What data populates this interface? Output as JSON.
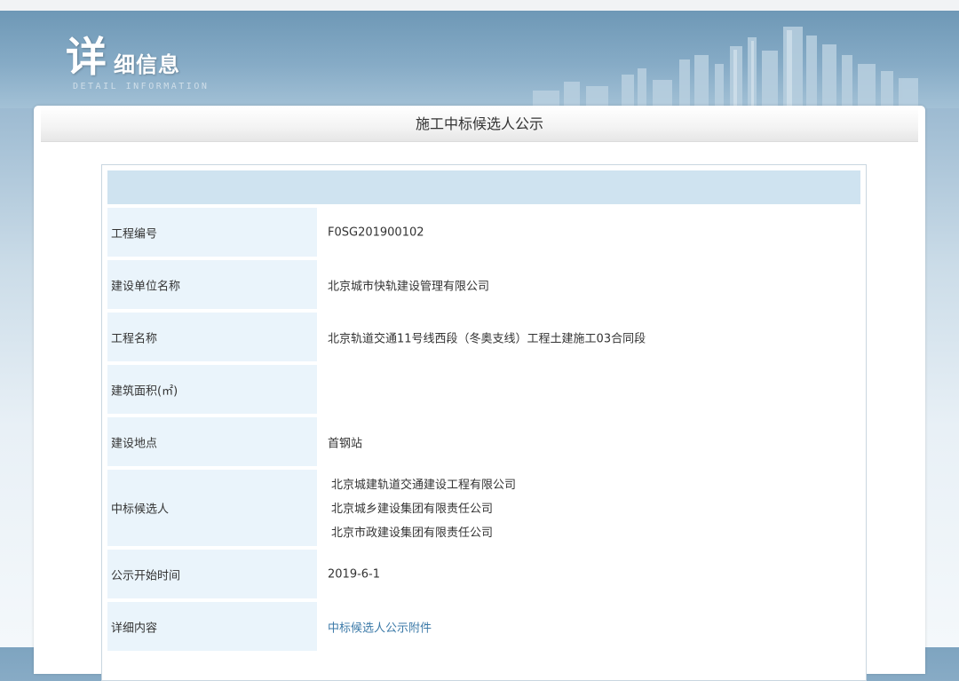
{
  "banner": {
    "logo_big": "详",
    "logo_rest": "细信息",
    "logo_en": "DETAIL INFORMATION"
  },
  "panel": {
    "title": "施工中标候选人公示"
  },
  "rows": [
    {
      "label": "工程编号",
      "value": "F0SG201900102"
    },
    {
      "label": "建设单位名称",
      "value": "北京城市快轨建设管理有限公司"
    },
    {
      "label": "工程名称",
      "value": "北京轨道交通11号线西段（冬奥支线）工程土建施工03合同段"
    },
    {
      "label": "建筑面积(㎡)",
      "value": ""
    },
    {
      "label": "建设地点",
      "value": "首钢站"
    },
    {
      "label": "中标候选人",
      "values": [
        "北京城建轨道交通建设工程有限公司",
        "北京城乡建设集团有限责任公司",
        "北京市政建设集团有限责任公司"
      ]
    },
    {
      "label": "公示开始时间",
      "value": "2019-6-1"
    },
    {
      "label": "详细内容",
      "value": "中标候选人公示附件"
    }
  ],
  "colors": {
    "label_bg": "#eaf4fb",
    "header_bar": "#cfe3f0",
    "link": "#3c7aa8"
  }
}
